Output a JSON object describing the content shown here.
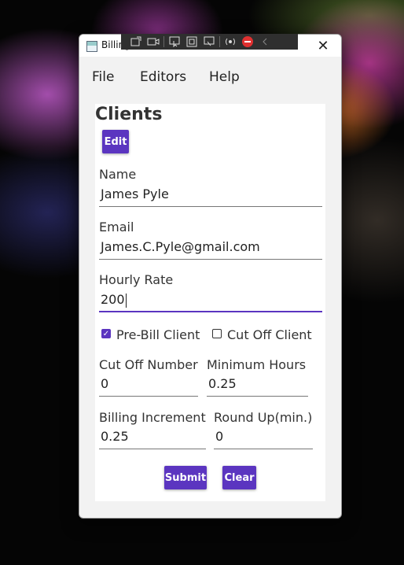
{
  "window": {
    "title": "Billing",
    "close_glyph": "✕"
  },
  "menu": [
    "File",
    "Editors",
    "Help"
  ],
  "card": {
    "title": "Clients",
    "edit_label": "Edit"
  },
  "fields": {
    "name_label": "Name",
    "name_value": "James Pyle",
    "email_label": "Email",
    "email_value": "James.C.Pyle@gmail.com",
    "hourly_label": "Hourly Rate",
    "hourly_value": "200",
    "cutoff_number_label": "Cut Off Number",
    "cutoff_number_value": "0",
    "min_hours_label": "Minimum Hours",
    "min_hours_value": "0.25",
    "billing_increment_label": "Billing Increment",
    "billing_increment_value": "0.25",
    "round_up_label": "Round Up(min.)",
    "round_up_value": "0"
  },
  "checkboxes": {
    "prebill_label": "Pre-Bill Client",
    "prebill_checked": true,
    "cutoff_label": "Cut Off Client",
    "cutoff_checked": false
  },
  "actions": {
    "submit_label": "Submit",
    "clear_label": "Clear"
  },
  "colors": {
    "accent": "#5b35c0"
  },
  "overlay_toolbar_icons": [
    "screenshot-icon",
    "record-icon",
    "pointer-icon",
    "window-icon",
    "region-icon",
    "audio-icon",
    "stop-icon",
    "collapse-icon"
  ]
}
